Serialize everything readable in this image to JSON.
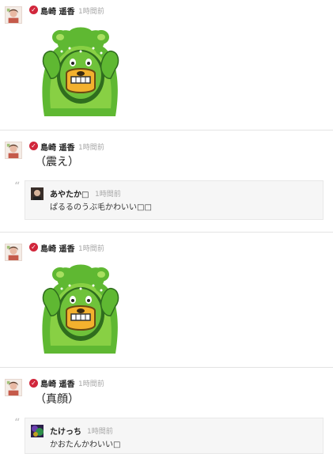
{
  "posts": [
    {
      "author": "島崎 遥香",
      "time": "1時間前",
      "kind": "stamp",
      "stamp_icon": "green-bear-stamp"
    },
    {
      "author": "島崎 遥香",
      "time": "1時間前",
      "kind": "text",
      "text": "（震え）",
      "reply": {
        "author": "あやたか□",
        "time": "1時間前",
        "text": "ぱるるのうぶ毛かわいい□□"
      }
    },
    {
      "author": "島崎 遥香",
      "time": "1時間前",
      "kind": "stamp",
      "stamp_icon": "green-bear-stamp"
    },
    {
      "author": "島崎 遥香",
      "time": "1時間前",
      "kind": "text",
      "text": "（真顔）",
      "reply": {
        "author": "たけっち",
        "time": "1時間前",
        "text": "かおたんかわいい□"
      }
    }
  ],
  "verified_badge": "✓",
  "quote_glyph": "“",
  "colors": {
    "badge": "#d1263b",
    "time": "#a7a7a7",
    "quote_bg": "#f6f6f6",
    "separator": "#e3e3e3",
    "bear_green": "#7cc43a"
  }
}
